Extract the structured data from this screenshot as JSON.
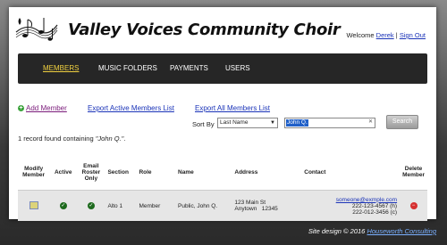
{
  "header": {
    "title": "Valley Voices Community Choir",
    "welcome_prefix": "Welcome",
    "user_name": "Derek",
    "separator": "|",
    "sign_out": "Sign Out"
  },
  "nav": {
    "items": [
      {
        "label": "MEMBERS",
        "active": true
      },
      {
        "label": "MUSIC FOLDERS",
        "active": false
      },
      {
        "label": "PAYMENTS",
        "active": false
      },
      {
        "label": "USERS",
        "active": false
      }
    ]
  },
  "actions": {
    "add_member": "Add Member",
    "export_active": "Export Active Members List",
    "export_all": "Export All Members List"
  },
  "search": {
    "sort_by_label": "Sort By",
    "sort_by_value": "Last Name",
    "query": "John Q.",
    "button": "Search"
  },
  "results": {
    "summary_prefix": "1 record found containing",
    "summary_query": "\"John Q.\"",
    "summary_suffix": "."
  },
  "table": {
    "headers": {
      "modify": "Modify Member",
      "active": "Active",
      "email_roster": "Email Roster Only",
      "section": "Section",
      "role": "Role",
      "name": "Name",
      "address": "Address",
      "contact": "Contact",
      "delete": "Delete Member"
    },
    "rows": [
      {
        "section": "Alto 1",
        "role": "Member",
        "name": "Public, John Q.",
        "address_line1": "123 Main St",
        "address_line2": "Anytown   12345",
        "email": "someone@exmple.com",
        "phone_h": "222-123-4567 (h)",
        "phone_c": "222-012-3456 (c)"
      }
    ]
  },
  "footer": {
    "text": "Site design © 2016",
    "link": "Houseworth Consulting"
  }
}
